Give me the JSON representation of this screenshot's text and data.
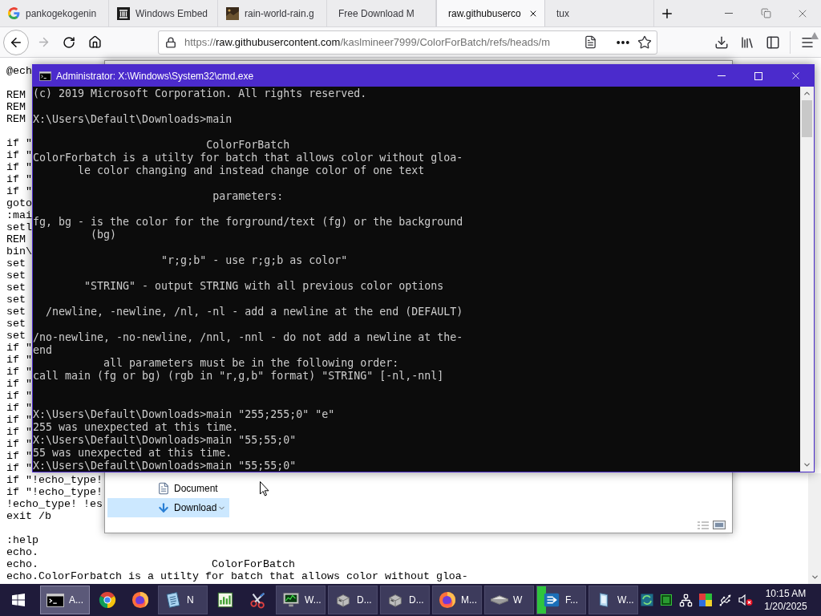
{
  "browser": {
    "tabs": [
      {
        "label": "pankogekogenin",
        "selected": false
      },
      {
        "label": "Windows Embed",
        "selected": false
      },
      {
        "label": "rain-world-rain.g",
        "selected": false
      },
      {
        "label": "Free Download M",
        "selected": false
      },
      {
        "label": "raw.githubuserco",
        "selected": true
      },
      {
        "label": "tux",
        "selected": false
      }
    ],
    "forward": {
      "disabled": true
    },
    "url": {
      "scheme": "https://",
      "host": "raw.githubusercontent.com",
      "path": "/kaslmineer7999/ColorForBatch/refs/heads/m"
    },
    "page_lines": [
      {
        "kind": "text",
        "text": "@ech"
      },
      {
        "kind": "blank"
      },
      {
        "kind": "text",
        "text": "REM"
      },
      {
        "kind": "text",
        "text": "REM"
      },
      {
        "kind": "text",
        "text": "REM"
      },
      {
        "kind": "blank"
      },
      {
        "kind": "text",
        "text": "if \""
      },
      {
        "kind": "text",
        "text": "if \""
      },
      {
        "kind": "text",
        "text": "if \""
      },
      {
        "kind": "text",
        "text": "if \""
      },
      {
        "kind": "text",
        "text": "if \""
      },
      {
        "kind": "text",
        "text": "goto"
      },
      {
        "kind": "text",
        "text": ":mai"
      },
      {
        "kind": "text",
        "text": "setl"
      },
      {
        "kind": "text",
        "text": "REM"
      },
      {
        "kind": "text",
        "text": "bin\\"
      },
      {
        "kind": "text",
        "text": "set"
      },
      {
        "kind": "text",
        "text": "set"
      },
      {
        "kind": "text",
        "text": "set"
      },
      {
        "kind": "text",
        "text": "set"
      },
      {
        "kind": "text",
        "text": "set"
      },
      {
        "kind": "text",
        "text": "set"
      },
      {
        "kind": "text",
        "text": "set"
      },
      {
        "kind": "text",
        "text": "if \""
      },
      {
        "kind": "text",
        "text": "if \""
      },
      {
        "kind": "text",
        "text": "if \""
      },
      {
        "kind": "text",
        "text": "if \""
      },
      {
        "kind": "text",
        "text": "if \""
      },
      {
        "kind": "text",
        "text": "if \""
      },
      {
        "kind": "text",
        "text": "if \""
      },
      {
        "kind": "text",
        "text": "if \""
      },
      {
        "kind": "text",
        "text": "if \""
      },
      {
        "kind": "text",
        "text": "if \""
      },
      {
        "kind": "text",
        "text": "if \""
      },
      {
        "kind": "text",
        "text": "if \"!echo_type!"
      },
      {
        "kind": "text",
        "text": "if \"!echo_type!"
      },
      {
        "kind": "text",
        "text": "!echo_type! !es"
      },
      {
        "kind": "text",
        "text": "exit /b"
      },
      {
        "kind": "blank"
      },
      {
        "kind": "text",
        "text": ":help"
      },
      {
        "kind": "text",
        "text": "echo."
      },
      {
        "kind": "text",
        "text": "echo.                           ColorForBatch"
      },
      {
        "kind": "text",
        "text": "echo.ColorForbatch is a utilty for batch that allows color without gloa-"
      }
    ]
  },
  "file_dialog": {
    "nav_items": [
      {
        "label": "Document",
        "selected": false
      },
      {
        "label": "Download",
        "selected": true
      }
    ]
  },
  "console": {
    "title": "Administrator: X:\\Windows\\System32\\cmd.exe",
    "lines": [
      {
        "kind": "text",
        "text": "(c) 2019 Microsoft Corporation. All rights reserved."
      },
      {
        "kind": "blank"
      },
      {
        "kind": "text",
        "text": "X:\\Users\\Default\\Downloads>main"
      },
      {
        "kind": "blank"
      },
      {
        "kind": "text",
        "text": "                           ColorForBatch"
      },
      {
        "kind": "text",
        "text": "ColorForbatch is a utilty for batch that allows color without gloa-"
      },
      {
        "kind": "text",
        "text": "       le color changing and instead change color of one text"
      },
      {
        "kind": "blank"
      },
      {
        "kind": "text",
        "text": "                            parameters:"
      },
      {
        "kind": "blank"
      },
      {
        "kind": "text",
        "text": "fg, bg - is the color for the forground/text (fg) or the background"
      },
      {
        "kind": "text",
        "text": "         (bg)"
      },
      {
        "kind": "blank"
      },
      {
        "kind": "text",
        "text": "                    \"r;g;b\" - use r;g;b as color\""
      },
      {
        "kind": "blank"
      },
      {
        "kind": "text",
        "text": "        \"STRING\" - output STRING with all previous color options"
      },
      {
        "kind": "blank"
      },
      {
        "kind": "text",
        "text": "  /newline, -newline, /nl, -nl - add a newline at the end (DEFAULT)"
      },
      {
        "kind": "blank"
      },
      {
        "kind": "text",
        "text": "/no-newline, -no-newline, /nnl, -nnl - do not add a newline at the-"
      },
      {
        "kind": "text",
        "text": "end"
      },
      {
        "kind": "text",
        "text": "           all parameters must be in the following order:"
      },
      {
        "kind": "text",
        "text": "call main (fg or bg) (rgb in \"r,g,b\" format) \"STRING\" [-nl,-nnl]"
      },
      {
        "kind": "blank"
      },
      {
        "kind": "blank"
      },
      {
        "kind": "text",
        "text": "X:\\Users\\Default\\Downloads>main \"255;255;0\" \"e\""
      },
      {
        "kind": "text",
        "text": "255 was unexpected at this time."
      },
      {
        "kind": "text",
        "text": "X:\\Users\\Default\\Downloads>main \"55;55;0\""
      },
      {
        "kind": "text",
        "text": "55 was unexpected at this time."
      },
      {
        "kind": "text",
        "text": "X:\\Users\\Default\\Downloads>main \"55;55;0\""
      }
    ]
  },
  "taskbar": {
    "items": [
      {
        "label": "A...",
        "selected": true,
        "open": true
      },
      {
        "selected": false,
        "open": false
      },
      {
        "selected": false,
        "open": false
      },
      {
        "label": "N",
        "selected": false,
        "open": true
      },
      {
        "selected": false,
        "open": false
      },
      {
        "selected": false,
        "open": false
      },
      {
        "label": "W...",
        "selected": false,
        "open": true
      },
      {
        "label": "D...",
        "selected": false,
        "open": true
      },
      {
        "label": "D...",
        "selected": false,
        "open": true
      },
      {
        "label": "M...",
        "selected": false,
        "open": true
      },
      {
        "label": "W",
        "selected": false,
        "open": true
      },
      {
        "label": "F...",
        "selected": false,
        "open": true,
        "level": 0.18
      },
      {
        "label": "W...",
        "selected": false,
        "open": true
      }
    ],
    "clock": {
      "time": "10:15 AM",
      "date": "1/20/2025"
    }
  }
}
